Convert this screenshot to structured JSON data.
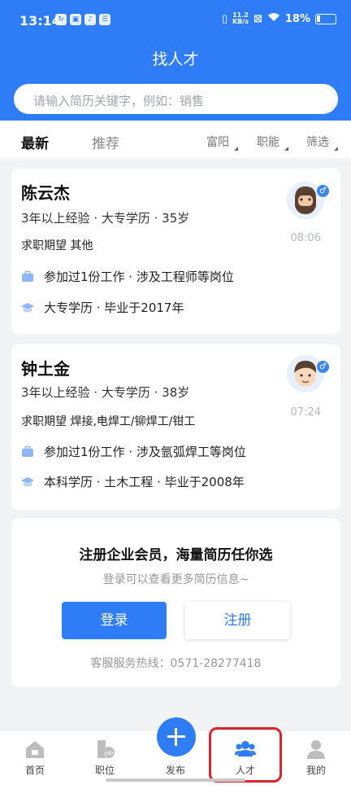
{
  "status_bar": {
    "time": "13:14",
    "net_speed_top": "11.2",
    "net_speed_unit": "KB/s",
    "battery": "18%"
  },
  "header": {
    "title": "找人才",
    "search_placeholder": "请输入简历关键字，例如：销售"
  },
  "tabs": {
    "latest": "最新",
    "recommend": "推荐",
    "filters": [
      "富阳",
      "职能",
      "筛选"
    ]
  },
  "candidates": [
    {
      "name": "陈云杰",
      "meta": "3年以上经验 · 大专学历 · 35岁",
      "expect": "求职期望 其他",
      "work": "参加过1份工作 · 涉及工程师等岗位",
      "education": "大专学历 · 毕业于2017年",
      "time": "08:06",
      "gender": "♂"
    },
    {
      "name": "钟土金",
      "meta": "3年以上经验 · 大专学历 · 38岁",
      "expect": "求职期望 焊接,电焊工/铆焊工/钳工",
      "work": "参加过1份工作 · 涉及氩弧焊工等岗位",
      "education": "本科学历 · 土木工程 · 毕业于2008年",
      "time": "07:24",
      "gender": "♂"
    }
  ],
  "promo": {
    "title": "注册企业会员，海量简历任你选",
    "subtitle": "登录可以查看更多简历信息~",
    "login": "登录",
    "register": "注册",
    "hotline": "客服服务热线：0571-28277418"
  },
  "tabbar": {
    "items": [
      "首页",
      "职位",
      "发布",
      "人才",
      "我的"
    ]
  },
  "colors": {
    "brand": "#2f7df6",
    "highlight": "#d8262c"
  }
}
